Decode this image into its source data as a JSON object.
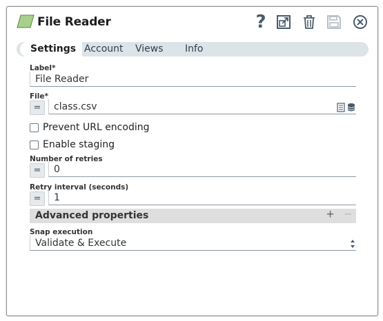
{
  "header": {
    "title": "File Reader",
    "help_glyph": "?",
    "icons": [
      "snap-icon",
      "help-icon",
      "export-icon",
      "trash-icon",
      "save-icon",
      "close-icon"
    ]
  },
  "tabs": [
    {
      "label": "Settings",
      "active": true
    },
    {
      "label": "Account",
      "active": false
    },
    {
      "label": "Views",
      "active": false
    },
    {
      "label": "Info",
      "active": false
    }
  ],
  "fields": {
    "label": {
      "label": "Label*",
      "value": "File Reader"
    },
    "file": {
      "label": "File*",
      "value": "class.csv",
      "expr_toggle": "="
    },
    "prevent_url_encoding": {
      "label": "Prevent URL encoding",
      "checked": false
    },
    "enable_staging": {
      "label": "Enable staging",
      "checked": false
    },
    "number_of_retries": {
      "label": "Number of retries",
      "value": "0",
      "expr_toggle": "="
    },
    "retry_interval": {
      "label": "Retry interval (seconds)",
      "value": "1",
      "expr_toggle": "="
    }
  },
  "advanced": {
    "title": "Advanced properties",
    "add_glyph": "+",
    "remove_glyph": "−"
  },
  "snap_execution": {
    "label": "Snap execution",
    "value": "Validate & Execute"
  },
  "colors": {
    "snap_icon_fill": "#a8d08d",
    "accent": "#4a5a6a",
    "tab_bar": "#dde4e8"
  }
}
